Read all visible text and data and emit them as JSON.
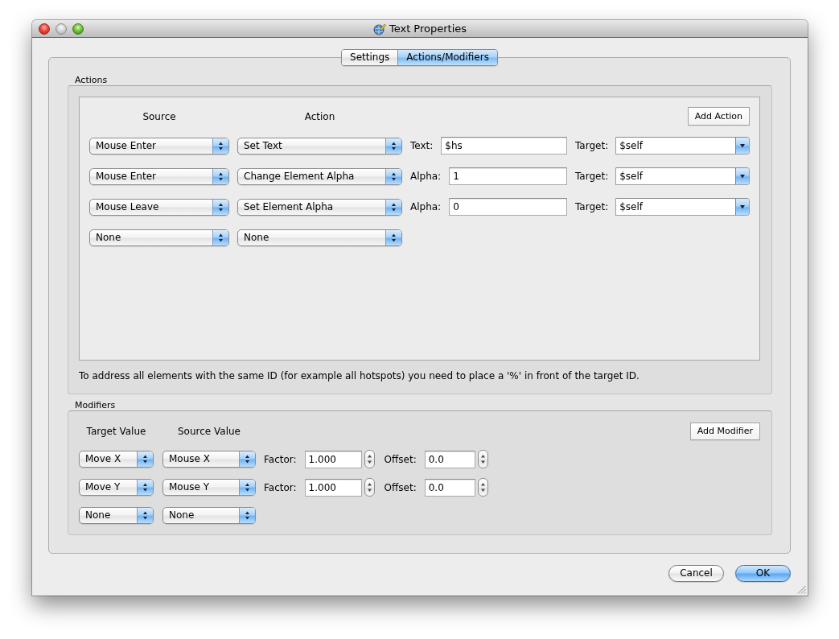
{
  "window": {
    "title": "Text Properties",
    "controls": [
      {
        "kind": "close",
        "disabled": false
      },
      {
        "kind": "minimize",
        "disabled": true
      },
      {
        "kind": "zoom",
        "disabled": false
      }
    ]
  },
  "tabs": [
    {
      "label": "Settings",
      "selected": false
    },
    {
      "label": "Actions/Modifiers",
      "selected": true
    }
  ],
  "actions": {
    "title": "Actions",
    "columns": [
      "Source",
      "Action"
    ],
    "add_button": "Add Action",
    "rows": [
      {
        "source": "Mouse Enter",
        "action": "Set Text",
        "parameter": {
          "label": "Text:",
          "value": "$hs"
        },
        "target": {
          "label": "Target:",
          "value": "$self"
        }
      },
      {
        "source": "Mouse Enter",
        "action": "Change Element Alpha",
        "parameter": {
          "label": "Alpha:",
          "value": "1"
        },
        "target": {
          "label": "Target:",
          "value": "$self"
        }
      },
      {
        "source": "Mouse Leave",
        "action": "Set Element Alpha",
        "parameter": {
          "label": "Alpha:",
          "value": "0"
        },
        "target": {
          "label": "Target:",
          "value": "$self"
        }
      },
      {
        "source": "None",
        "action": "None"
      }
    ],
    "note": "To address all elements with the same ID (for example all hotspots) you need to place a '%' in front of the target ID."
  },
  "modifiers": {
    "title": "Modifiers",
    "columns": [
      "Target Value",
      "Source Value"
    ],
    "add_button": "Add Modifier",
    "rows": [
      {
        "target": "Move X",
        "source": "Mouse X",
        "factor": {
          "label": "Factor:",
          "value": "1.000"
        },
        "offset": {
          "label": "Offset:",
          "value": "0.0"
        }
      },
      {
        "target": "Move Y",
        "source": "Mouse Y",
        "factor": {
          "label": "Factor:",
          "value": "1.000"
        },
        "offset": {
          "label": "Offset:",
          "value": "0.0"
        }
      },
      {
        "target": "None",
        "source": "None"
      }
    ]
  },
  "buttons": [
    {
      "label": "Cancel",
      "default": false
    },
    {
      "label": "OK",
      "default": true
    }
  ]
}
